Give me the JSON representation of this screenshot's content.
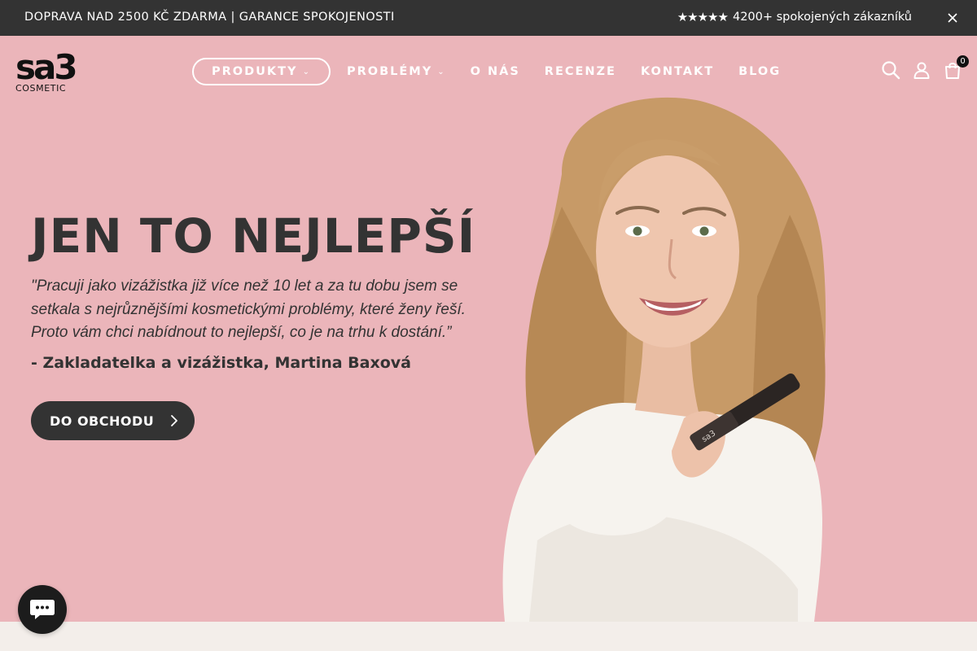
{
  "announcement": {
    "text": "DOPRAVA NAD 2500 KČ ZDARMA | GARANCE SPOKOJENOSTI",
    "stars": "★★★★★",
    "rating_text": "4200+ spokojených zákazníků",
    "close_icon": "close-icon"
  },
  "header": {
    "logo_mark": "sa3",
    "logo_sub": "COSMETIC",
    "nav": [
      {
        "label": "PRODUKTY",
        "has_dropdown": true
      },
      {
        "label": "PROBLÉMY",
        "has_dropdown": true
      },
      {
        "label": "O NÁS",
        "has_dropdown": false
      },
      {
        "label": "RECENZE",
        "has_dropdown": false
      },
      {
        "label": "KONTAKT",
        "has_dropdown": false
      },
      {
        "label": "BLOG",
        "has_dropdown": false
      }
    ],
    "icons": [
      "search-icon",
      "account-icon",
      "cart-icon"
    ],
    "cart_count": "0"
  },
  "hero": {
    "headline": "JEN TO NEJLEPŠÍ",
    "quote": "\"Pracuji jako vizážistka již více než 10 let a za tu dobu jsem se setkala s nejrůznějšími kosmetickými problémy, které ženy řeší. Proto vám chci nabídnout to nejlepší, co je na trhu k dostání.”",
    "author": "- Zakladatelka a vizážistka, Martina Baxová",
    "cta_label": "DO OBCHODU",
    "background_color": "#ebb5ba",
    "product_brand": "sa3"
  },
  "chat": {
    "icon": "chat-icon"
  },
  "colors": {
    "dark": "#333333",
    "topbar": "#333333",
    "hero_bg": "#ebb5ba",
    "page_bg": "#f3eeea"
  }
}
